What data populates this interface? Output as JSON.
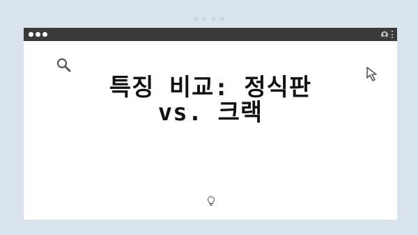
{
  "app": {
    "window_title": "",
    "heading": "특징 비교: 정식판 vs. 크랙"
  },
  "icons": {
    "search": "search-icon",
    "cursor": "cursor-arrow-icon",
    "bulb": "lightbulb-icon",
    "user": "user-icon",
    "menu": "kebab-menu-icon"
  },
  "colors": {
    "background": "#d9e3ed",
    "titlebar": "#3a3a3a",
    "window": "#ffffff",
    "text": "#111111"
  }
}
